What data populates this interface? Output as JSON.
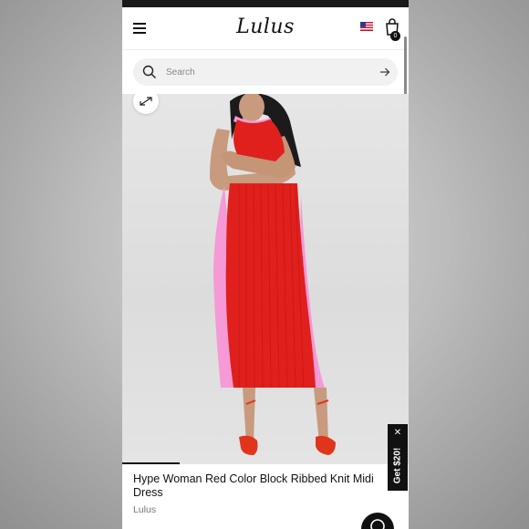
{
  "header": {
    "logo_text": "Lulus",
    "cart_count": "0",
    "menu_icon": "hamburger-menu-icon",
    "flag_icon": "us-flag-icon",
    "cart_icon": "shopping-bag-icon"
  },
  "search": {
    "placeholder": "Search",
    "icon": "search-icon",
    "submit_icon": "arrow-right-icon"
  },
  "product": {
    "title": "Hype Woman Red Color Block Ribbed Knit Midi Dress",
    "brand": "Lulus",
    "expand_icon": "expand-icon",
    "image_progress": 0.2
  },
  "promo": {
    "label": "Get $20!",
    "close_icon": "close-icon"
  },
  "chat": {
    "icon": "chat-icon"
  },
  "colors": {
    "dress_red": "#e0201c",
    "dress_pink": "#f59ad6",
    "promo_bg": "#111111"
  }
}
